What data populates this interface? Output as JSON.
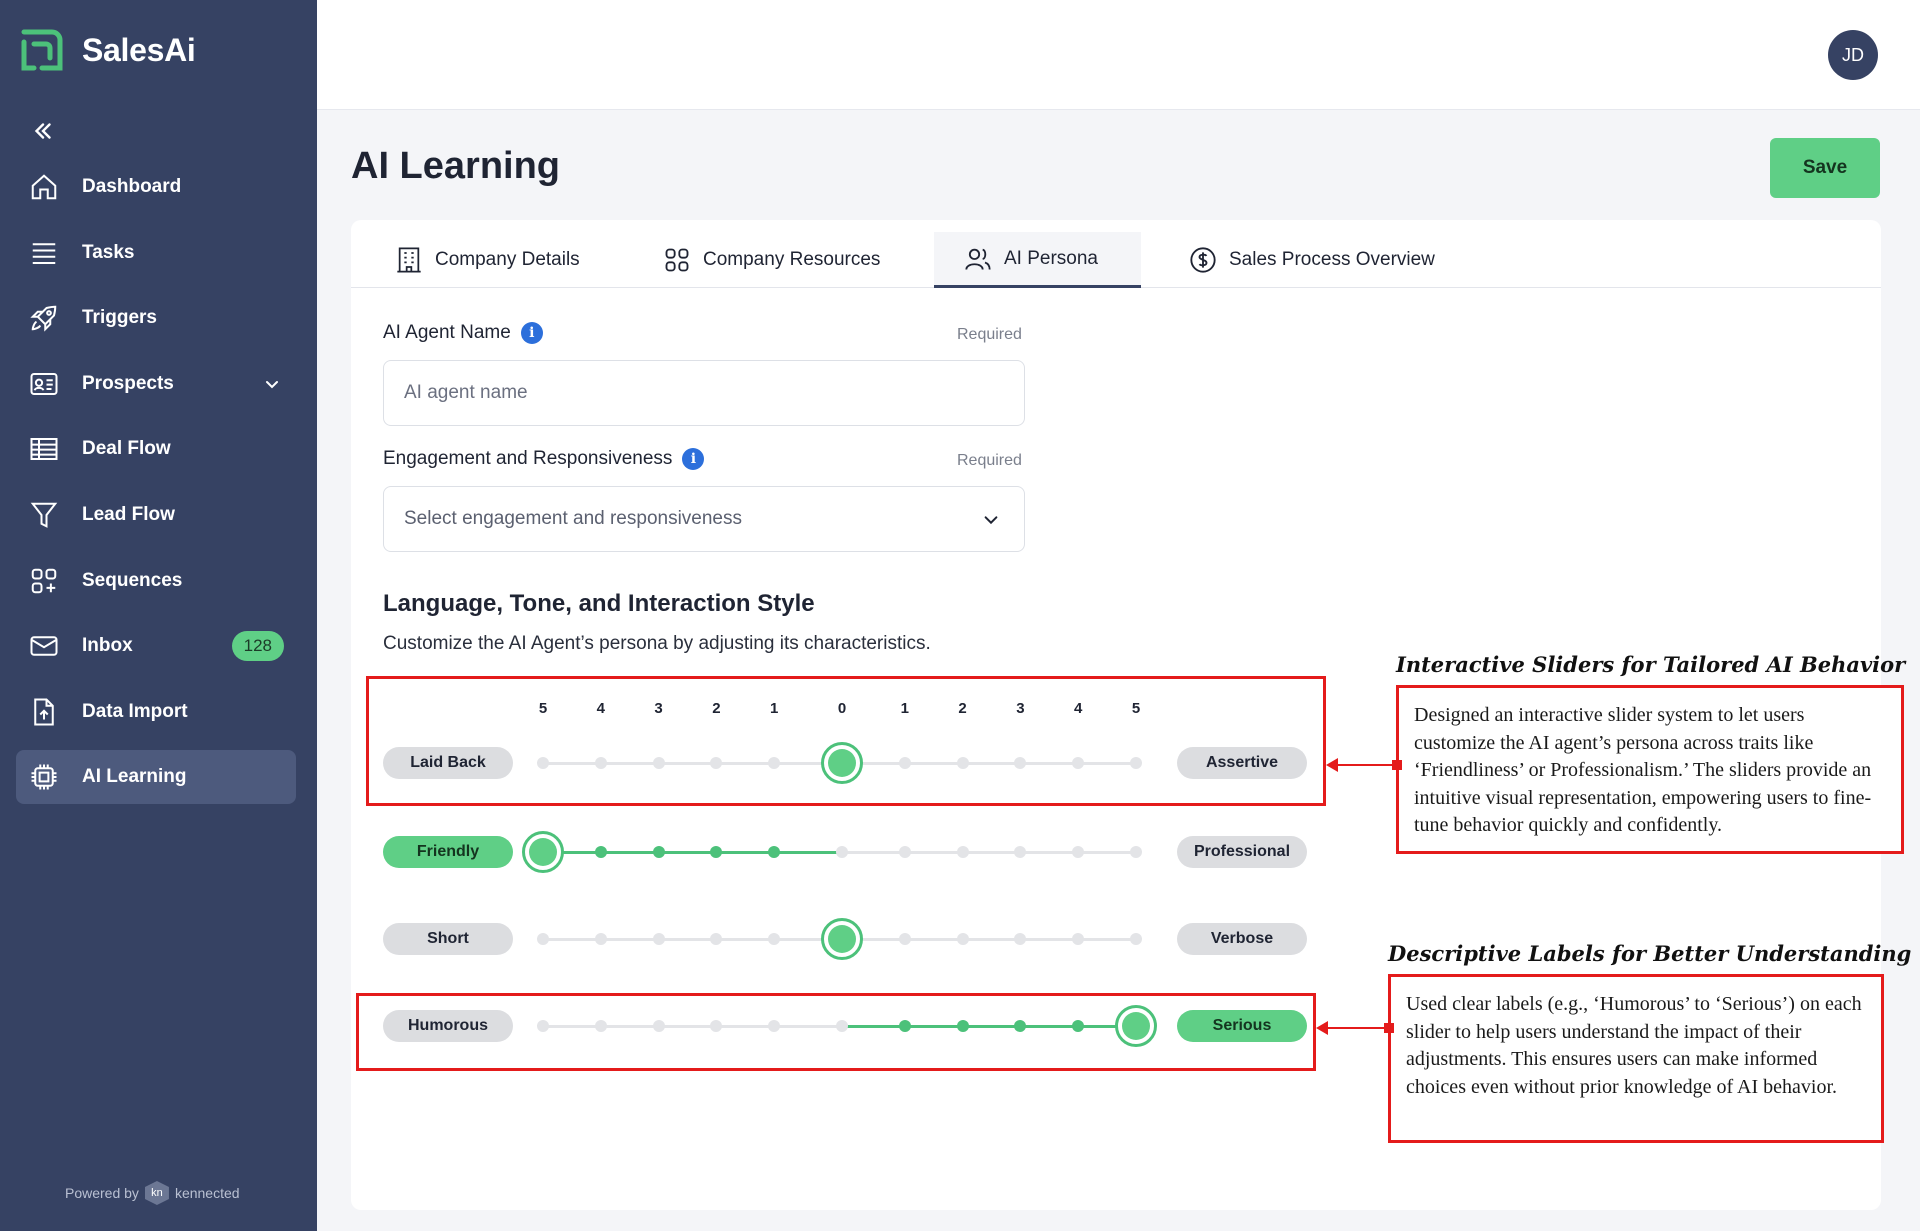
{
  "app": {
    "name": "SalesAi",
    "powered_by": "Powered by",
    "powered_brand": "kennected",
    "powered_logo_text": "kn"
  },
  "sidebar": {
    "items": [
      {
        "label": "Dashboard",
        "icon": "home-icon"
      },
      {
        "label": "Tasks",
        "icon": "list-icon"
      },
      {
        "label": "Triggers",
        "icon": "rocket-icon"
      },
      {
        "label": "Prospects",
        "icon": "contact-card-icon",
        "expandable": true
      },
      {
        "label": "Deal Flow",
        "icon": "table-icon"
      },
      {
        "label": "Lead Flow",
        "icon": "funnel-icon"
      },
      {
        "label": "Sequences",
        "icon": "grid-plus-icon"
      },
      {
        "label": "Inbox",
        "icon": "mail-icon",
        "badge": "128"
      },
      {
        "label": "Data Import",
        "icon": "file-import-icon"
      },
      {
        "label": "AI Learning",
        "icon": "chip-icon",
        "active": true
      }
    ]
  },
  "header": {
    "avatar_initials": "JD"
  },
  "page": {
    "title": "AI Learning",
    "save_label": "Save"
  },
  "tabs": [
    {
      "label": "Company Details",
      "icon": "building-icon"
    },
    {
      "label": "Company Resources",
      "icon": "grid-icon"
    },
    {
      "label": "AI Persona",
      "icon": "users-icon",
      "active": true
    },
    {
      "label": "Sales Process Overview",
      "icon": "dollar-circle-icon"
    }
  ],
  "form": {
    "agent_name": {
      "label": "AI Agent Name",
      "required": "Required",
      "placeholder": "AI agent name",
      "value": ""
    },
    "engagement": {
      "label": "Engagement and Responsiveness",
      "required": "Required",
      "placeholder": "Select engagement and responsiveness"
    }
  },
  "style_section": {
    "title": "Language, Tone, and Interaction Style",
    "description": "Customize the AI Agent’s persona by adjusting its characteristics.",
    "scale": [
      "5",
      "4",
      "3",
      "2",
      "1",
      "0",
      "1",
      "2",
      "3",
      "4",
      "5"
    ],
    "sliders": [
      {
        "left": "Laid Back",
        "right": "Assertive",
        "value": 0,
        "left_active": false,
        "right_active": false
      },
      {
        "left": "Friendly",
        "right": "Professional",
        "value": -5,
        "left_active": true,
        "right_active": false
      },
      {
        "left": "Short",
        "right": "Verbose",
        "value": 0,
        "left_active": false,
        "right_active": false
      },
      {
        "left": "Humorous",
        "right": "Serious",
        "value": 5,
        "left_active": false,
        "right_active": true
      }
    ]
  },
  "annotations": [
    {
      "title": "Interactive Sliders for Tailored AI Behavior",
      "body": "Designed an interactive slider system to let users customize the AI agent’s persona across traits like ‘Friendliness’ or Professionalism.’ The sliders provide an intuitive visual representation, empowering users to fine-tune behavior quickly and confidently."
    },
    {
      "title": "Descriptive Labels for Better Understanding",
      "body": "Used clear labels (e.g., ‘Humorous’ to ‘Serious’) on each slider to help users understand the impact of their adjustments. This ensures users can make informed choices even without prior knowledge of AI behavior."
    }
  ],
  "colors": {
    "sidebar": "#364263",
    "accent": "#5fcf86",
    "annotation": "#e41b1b"
  }
}
